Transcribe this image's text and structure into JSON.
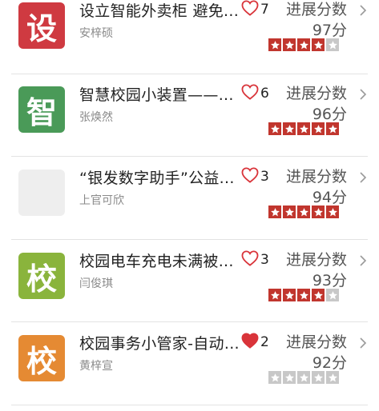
{
  "items": [
    {
      "icon_char": "设",
      "icon_color": "#cf3a41",
      "title": "设立智能外卖柜 避免...",
      "author": "安梓硕",
      "likes": "7",
      "liked": false,
      "progress_label": "进展分数",
      "score": "97分",
      "stars_filled": 4
    },
    {
      "icon_char": "智",
      "icon_color": "#4a9a58",
      "title": "智慧校园小装置——...",
      "author": "张焕然",
      "likes": "6",
      "liked": false,
      "progress_label": "进展分数",
      "score": "96分",
      "stars_filled": 5
    },
    {
      "icon_char": "",
      "icon_color": "#eeeeee",
      "title": "“银发数字助手”公益...",
      "author": "上官可欣",
      "likes": "3",
      "liked": false,
      "progress_label": "进展分数",
      "score": "94分",
      "stars_filled": 5
    },
    {
      "icon_char": "校",
      "icon_color": "#8ab43c",
      "title": "校园电车充电未满被...",
      "author": "闫俊琪",
      "likes": "3",
      "liked": false,
      "progress_label": "进展分数",
      "score": "93分",
      "stars_filled": 4
    },
    {
      "icon_char": "校",
      "icon_color": "#e58a33",
      "title": "校园事务小管家-自动...",
      "author": "黄梓宣",
      "likes": "2",
      "liked": true,
      "progress_label": "进展分数",
      "score": "92分",
      "stars_filled": 0
    }
  ],
  "colors": {
    "heart": "#d9343a",
    "star_on": "#c1362e",
    "star_off": "#c8c8c8"
  },
  "icons": {
    "like": "heart-icon",
    "rating": "star-icon",
    "nav": "chevron-right-icon"
  }
}
